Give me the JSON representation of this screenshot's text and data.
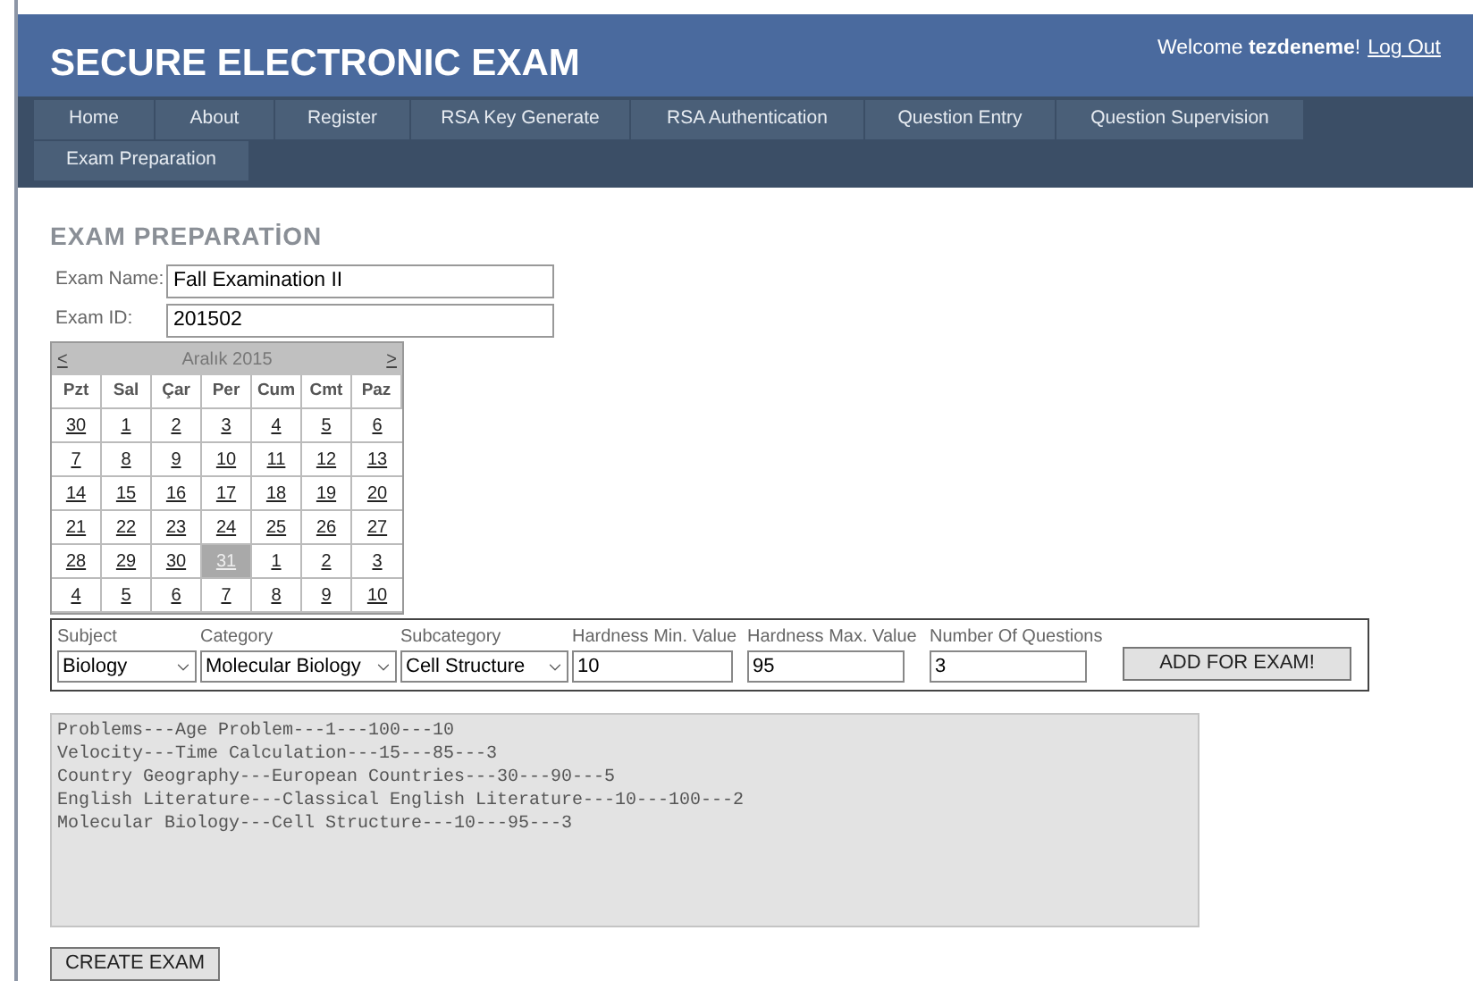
{
  "header": {
    "title": "SECURE ELECTRONIC EXAM",
    "welcome": "Welcome **tezdeneme**!",
    "logout": "Log Out"
  },
  "nav": [
    {
      "label": "Home"
    },
    {
      "label": "About"
    },
    {
      "label": "Register"
    },
    {
      "label": "RSA Key Generate"
    },
    {
      "label": "RSA Authentication"
    },
    {
      "label": "Question Entry"
    },
    {
      "label": "Question Supervision"
    },
    {
      "label": "Exam Preparation"
    }
  ],
  "page_title": "EXAM PREPARATİON",
  "exam_name": {
    "label": "Exam Name:",
    "value": "Fall Examination II"
  },
  "exam_id": {
    "label": "Exam ID:",
    "value": "201502"
  },
  "calendar": {
    "prev": "<",
    "month": "Aralık 2015",
    "next": ">",
    "weekdays": [
      "Pzt",
      "Sal",
      "Çar",
      "Per",
      "Cum",
      "Cmt",
      "Paz"
    ],
    "weeks": [
      [
        {
          "day": "30",
          "selected": false
        },
        {
          "day": "1",
          "selected": false
        },
        {
          "day": "2",
          "selected": false
        },
        {
          "day": "3",
          "selected": false
        },
        {
          "day": "4",
          "selected": false
        },
        {
          "day": "5",
          "selected": false
        },
        {
          "day": "6",
          "selected": false
        }
      ],
      [
        {
          "day": "7",
          "selected": false
        },
        {
          "day": "8",
          "selected": false
        },
        {
          "day": "9",
          "selected": false
        },
        {
          "day": "10",
          "selected": false
        },
        {
          "day": "11",
          "selected": false
        },
        {
          "day": "12",
          "selected": false
        },
        {
          "day": "13",
          "selected": false
        }
      ],
      [
        {
          "day": "14",
          "selected": false
        },
        {
          "day": "15",
          "selected": false
        },
        {
          "day": "16",
          "selected": false
        },
        {
          "day": "17",
          "selected": false
        },
        {
          "day": "18",
          "selected": false
        },
        {
          "day": "19",
          "selected": false
        },
        {
          "day": "20",
          "selected": false
        }
      ],
      [
        {
          "day": "21",
          "selected": false
        },
        {
          "day": "22",
          "selected": false
        },
        {
          "day": "23",
          "selected": false
        },
        {
          "day": "24",
          "selected": false
        },
        {
          "day": "25",
          "selected": false
        },
        {
          "day": "26",
          "selected": false
        },
        {
          "day": "27",
          "selected": false
        }
      ],
      [
        {
          "day": "28",
          "selected": false
        },
        {
          "day": "29",
          "selected": false
        },
        {
          "day": "30",
          "selected": false
        },
        {
          "day": "31",
          "selected": true
        },
        {
          "day": "1",
          "selected": false
        },
        {
          "day": "2",
          "selected": false
        },
        {
          "day": "3",
          "selected": false
        }
      ],
      [
        {
          "day": "4",
          "selected": false
        },
        {
          "day": "5",
          "selected": false
        },
        {
          "day": "6",
          "selected": false
        },
        {
          "day": "7",
          "selected": false
        },
        {
          "day": "8",
          "selected": false
        },
        {
          "day": "9",
          "selected": false
        },
        {
          "day": "10",
          "selected": false
        }
      ]
    ]
  },
  "filters": [
    {
      "kind": "select",
      "label": "Subject",
      "value": "Biology"
    },
    {
      "kind": "select",
      "label": "Category",
      "value": "Molecular Biology"
    },
    {
      "kind": "select",
      "label": "Subcategory",
      "value": "Cell Structure"
    },
    {
      "kind": "input",
      "label": "Hardness Min. Value",
      "value": "10"
    },
    {
      "kind": "input",
      "label": "Hardness Max. Value",
      "value": "95"
    },
    {
      "kind": "input",
      "label": "Number Of Questions",
      "value": "3"
    }
  ],
  "add_button": "ADD FOR EXAM!",
  "exam_list": [
    "Problems---Age Problem---1---100---10",
    "Velocity---Time Calculation---15---85---3",
    "Country Geography---European Countries---30---90---5",
    "English Literature---Classical English Literature---10---100---2",
    "Molecular Biology---Cell Structure---10---95---3"
  ],
  "create_button": "CREATE EXAM"
}
